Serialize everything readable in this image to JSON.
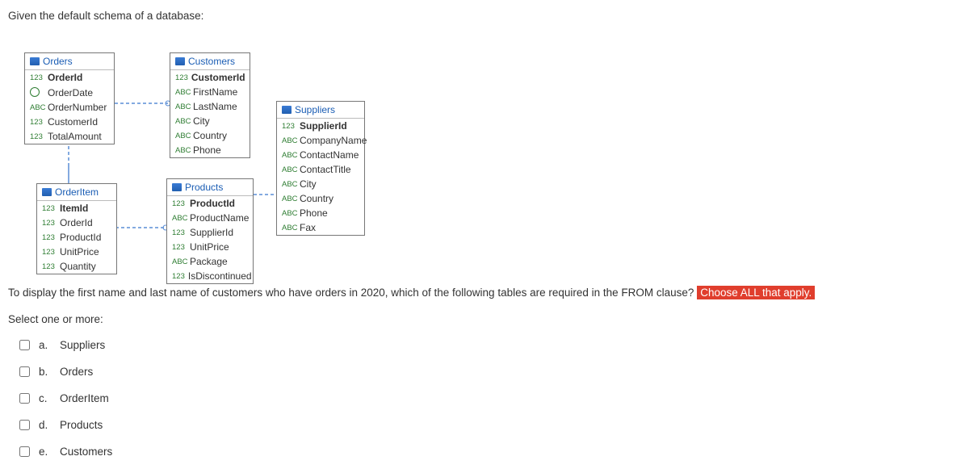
{
  "intro_text": "Given the default schema of a database:",
  "entities": {
    "orders": {
      "title": "Orders",
      "fields": [
        {
          "type": "123",
          "name": "OrderId",
          "key": true
        },
        {
          "type": "date",
          "name": "OrderDate"
        },
        {
          "type": "ABC",
          "name": "OrderNumber"
        },
        {
          "type": "123",
          "name": "CustomerId"
        },
        {
          "type": "123",
          "name": "TotalAmount"
        }
      ]
    },
    "customers": {
      "title": "Customers",
      "fields": [
        {
          "type": "123",
          "name": "CustomerId",
          "key": true
        },
        {
          "type": "ABC",
          "name": "FirstName"
        },
        {
          "type": "ABC",
          "name": "LastName"
        },
        {
          "type": "ABC",
          "name": "City"
        },
        {
          "type": "ABC",
          "name": "Country"
        },
        {
          "type": "ABC",
          "name": "Phone"
        }
      ]
    },
    "orderitem": {
      "title": "OrderItem",
      "fields": [
        {
          "type": "123",
          "name": "ItemId",
          "key": true
        },
        {
          "type": "123",
          "name": "OrderId"
        },
        {
          "type": "123",
          "name": "ProductId"
        },
        {
          "type": "123",
          "name": "UnitPrice"
        },
        {
          "type": "123",
          "name": "Quantity"
        }
      ]
    },
    "products": {
      "title": "Products",
      "fields": [
        {
          "type": "123",
          "name": "ProductId",
          "key": true
        },
        {
          "type": "ABC",
          "name": "ProductName"
        },
        {
          "type": "123",
          "name": "SupplierId"
        },
        {
          "type": "123",
          "name": "UnitPrice"
        },
        {
          "type": "ABC",
          "name": "Package"
        },
        {
          "type": "123",
          "name": "IsDiscontinued"
        }
      ]
    },
    "suppliers": {
      "title": "Suppliers",
      "fields": [
        {
          "type": "123",
          "name": "SupplierId",
          "key": true
        },
        {
          "type": "ABC",
          "name": "CompanyName"
        },
        {
          "type": "ABC",
          "name": "ContactName"
        },
        {
          "type": "ABC",
          "name": "ContactTitle"
        },
        {
          "type": "ABC",
          "name": "City"
        },
        {
          "type": "ABC",
          "name": "Country"
        },
        {
          "type": "ABC",
          "name": "Phone"
        },
        {
          "type": "ABC",
          "name": "Fax"
        }
      ]
    }
  },
  "question_prefix": "To display the first name and last name of customers who have orders in 2020, which of the following tables are required in the FROM clause? ",
  "question_highlight": "Choose ALL that apply.",
  "select_label": "Select one or more:",
  "options": [
    {
      "letter": "a.",
      "label": "Suppliers"
    },
    {
      "letter": "b.",
      "label": "Orders"
    },
    {
      "letter": "c.",
      "label": "OrderItem"
    },
    {
      "letter": "d.",
      "label": "Products"
    },
    {
      "letter": "e.",
      "label": "Customers"
    }
  ]
}
